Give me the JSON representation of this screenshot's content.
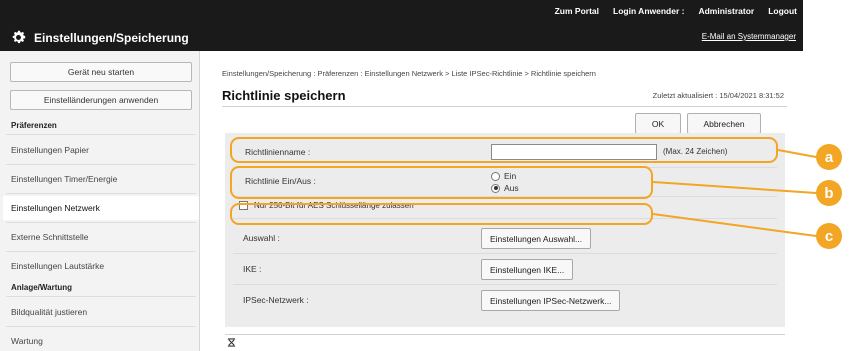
{
  "header": {
    "title": "Einstellungen/Speicherung",
    "links": [
      "Zum Portal",
      "Login Anwender :",
      "Administrator",
      "Logout"
    ],
    "email_link": "E-Mail an Systemmanager"
  },
  "sidebar": {
    "buttons": [
      "Gerät neu starten",
      "Einstelländerungen anwenden"
    ],
    "sections": [
      {
        "label": "Präferenzen",
        "items": [
          "Einstellungen Papier",
          "Einstellungen Timer/Energie",
          "Einstellungen Netzwerk",
          "Externe Schnittstelle",
          "Einstellungen Lautstärke"
        ]
      },
      {
        "label": "Anlage/Wartung",
        "items": [
          "Bildqualität justieren",
          "Wartung"
        ]
      }
    ],
    "active_item": "Einstellungen Netzwerk"
  },
  "main": {
    "breadcrumb": "Einstellungen/Speicherung : Präferenzen : Einstellungen Netzwerk > Liste IPSec-Richtlinie > Richtlinie speichern",
    "title": "Richtlinie speichern",
    "updated": "Zuletzt aktualisiert : 15/04/2021 8:31:52",
    "ok_label": "OK",
    "cancel_label": "Abbrechen",
    "form": {
      "policy_name_label": "Richtlinienname :",
      "policy_name_value": "",
      "policy_name_hint": "(Max. 24 Zeichen)",
      "policy_onoff_label": "Richtlinie Ein/Aus :",
      "radio_on": "Ein",
      "radio_off": "Aus",
      "radio_selected": "Aus",
      "aes_checkbox_label": "Nur 256-Bit für AES Schlüssellänge zulassen",
      "aes_checked": false,
      "selection_label": "Auswahl :",
      "selection_button": "Einstellungen Auswahl...",
      "ike_label": "IKE :",
      "ike_button": "Einstellungen IKE...",
      "ipsec_label": "IPSec-Netzwerk :",
      "ipsec_button": "Einstellungen IPSec-Netzwerk..."
    }
  },
  "callouts": [
    "a",
    "b",
    "c"
  ],
  "colors": {
    "header_bg": "#1a1a1a",
    "callout": "#f2a623",
    "panel_bg": "#ececec"
  }
}
